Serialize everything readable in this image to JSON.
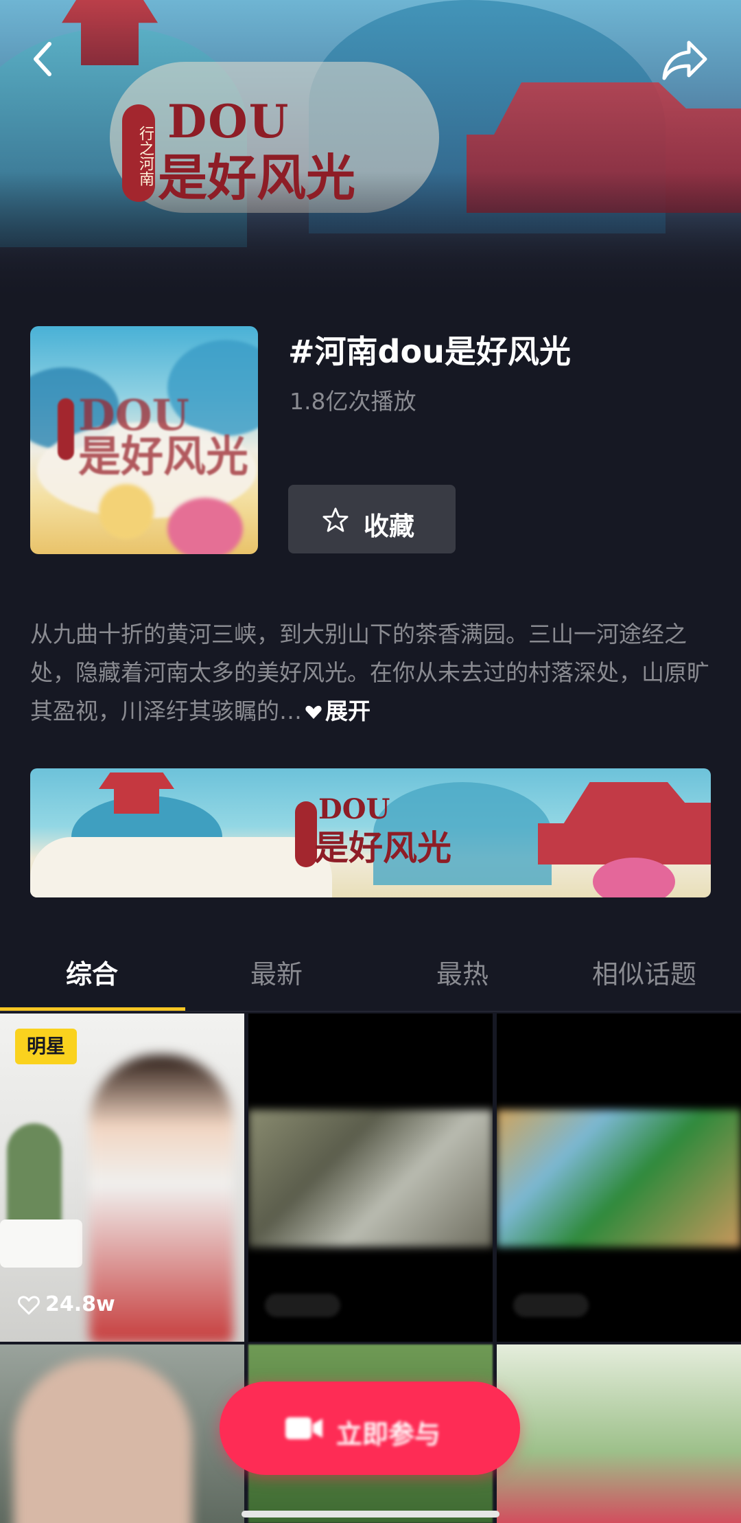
{
  "header": {
    "back_icon": "chevron-left-icon",
    "share_icon": "share-arrow-icon",
    "banner_logo": {
      "seal": "行之河南",
      "brand": "DOU",
      "slogan": "是好风光"
    }
  },
  "topic": {
    "title": "#河南dou是好风光",
    "play_count": "1.8亿次播放",
    "favorite_label": "收藏",
    "cover_logo": {
      "seal": "行之河南",
      "brand": "DOU",
      "slogan": "是好风光"
    }
  },
  "description": {
    "text": "从九曲十折的黄河三峡，到大别山下的茶香满园。三山一河途经之处，隐藏着河南太多的美好风光。在你从未去过的村落深处，山原旷其盈视，川泽纡其骇瞩的…",
    "expand_label": "展开"
  },
  "promo_banner": {
    "seal": "行之河南",
    "brand": "DOU",
    "slogan": "是好风光"
  },
  "tabs": [
    {
      "label": "综合",
      "active": true
    },
    {
      "label": "最新",
      "active": false
    },
    {
      "label": "最热",
      "active": false
    },
    {
      "label": "相似话题",
      "active": false
    }
  ],
  "videos": [
    {
      "badge": "明星",
      "likes": "24.8w"
    }
  ],
  "join_button": {
    "label": "立即参与"
  },
  "colors": {
    "background": "#161823",
    "accent_yellow": "#fac723",
    "join_red": "#fe2c55",
    "muted_text": "#8a8b91"
  }
}
